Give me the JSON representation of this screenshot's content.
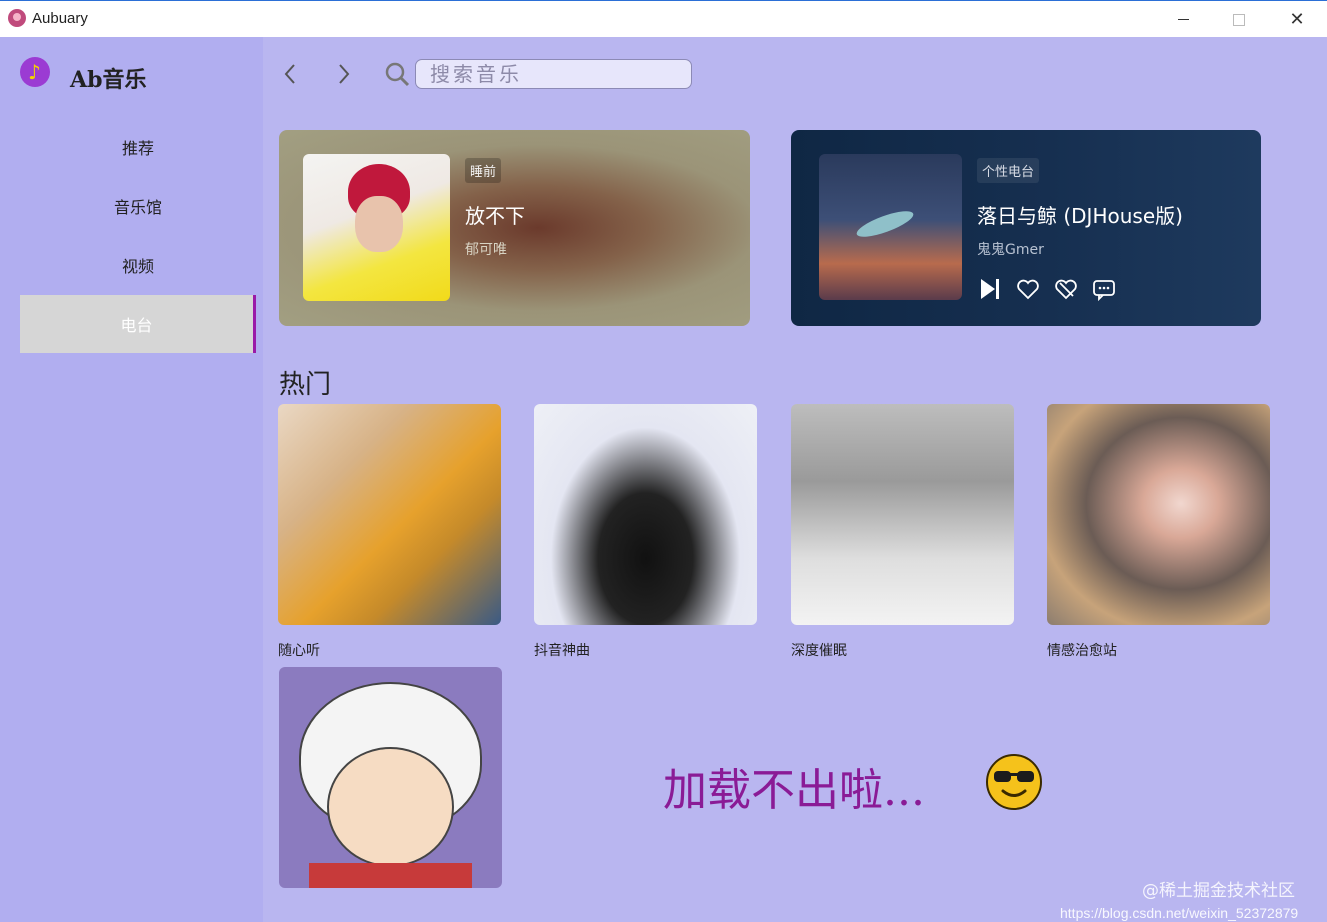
{
  "window": {
    "title": "Aubuary"
  },
  "sidebar": {
    "brand": "Ab音乐",
    "items": [
      {
        "label": "推荐",
        "active": false
      },
      {
        "label": "音乐馆",
        "active": false
      },
      {
        "label": "视频",
        "active": false
      },
      {
        "label": "电台",
        "active": true
      }
    ]
  },
  "search": {
    "placeholder": "搜索音乐",
    "value": ""
  },
  "featured": [
    {
      "tag": "睡前",
      "title": "放不下",
      "artist": "郁可唯"
    },
    {
      "tag": "个性电台",
      "title": "落日与鲸 (DJHouse版)",
      "artist": "鬼鬼Gmer"
    }
  ],
  "hot": {
    "title": "热门",
    "items": [
      {
        "label": "随心听"
      },
      {
        "label": "抖音神曲"
      },
      {
        "label": "深度催眠"
      },
      {
        "label": "情感治愈站"
      }
    ]
  },
  "loading_text": "加载不出啦...",
  "watermark": {
    "line1": "@稀土掘金技术社区",
    "line2": "https://blog.csdn.net/weixin_52372879"
  },
  "colors": {
    "background": "#b9b6f0",
    "sidebar": "#b1aef0",
    "accent": "#9a1aa8",
    "loading": "#8a1b96"
  }
}
